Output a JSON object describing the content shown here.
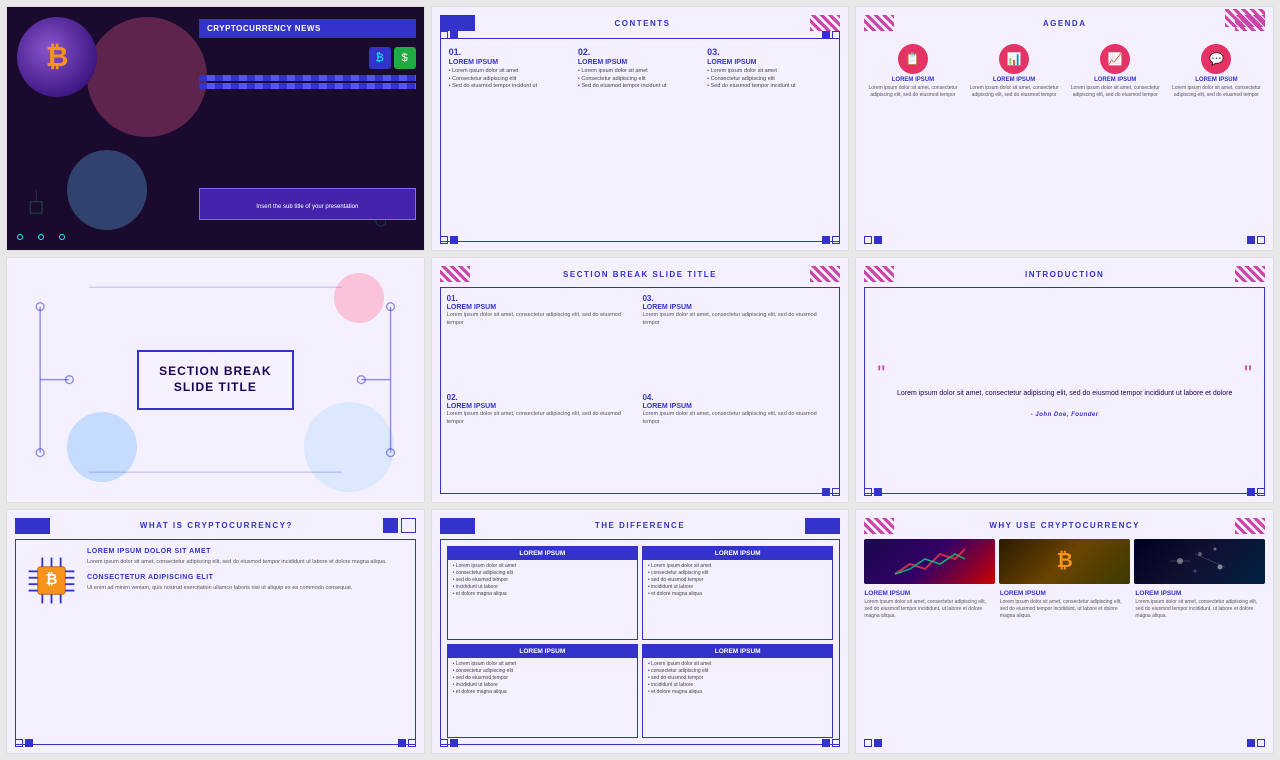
{
  "slides": [
    {
      "id": 1,
      "type": "title",
      "title": "CRYPTOCURRENCY NEWS",
      "subtitle": "Insert the sub title of your presentation"
    },
    {
      "id": 2,
      "type": "contents",
      "header": "CONTENTS",
      "items": [
        {
          "num": "01.",
          "heading": "LOREM IPSUM",
          "bullets": [
            "Lorem ipsum dolor sit amet",
            "Consectetur adipiscing elit",
            "Sed do eiusmod tempor incidunt ut"
          ]
        },
        {
          "num": "02.",
          "heading": "LOREM IPSUM",
          "bullets": [
            "Lorem ipsum dolor sit amet",
            "Consectetur adipiscing elit",
            "Sed do eiusmod tempor incidunt ut"
          ]
        },
        {
          "num": "03.",
          "heading": "LOREM IPSUM",
          "bullets": [
            "Lorem ipsum dolor sit amet",
            "Consectetur adipiscing elit",
            "Sed do eiusmod tempor incidunt ut"
          ]
        }
      ]
    },
    {
      "id": 3,
      "type": "agenda",
      "header": "AGENDA",
      "items": [
        {
          "icon": "📋",
          "label": "LOREM IPSUM",
          "desc": "Lorem ipsum dolor sit amet, consectetur adipiscing elit, sed do eiusmod tempor"
        },
        {
          "icon": "📊",
          "label": "LOREM IPSUM",
          "desc": "Lorem ipsum dolor sit amet, consectetur adipiscing elit, sed do eiusmod tempor"
        },
        {
          "icon": "📈",
          "label": "LOREM IPSUM",
          "desc": "Lorem ipsum dolor sit amet, consectetur adipiscing elit, sed do eiusmod tempor"
        },
        {
          "icon": "💬",
          "label": "LOREM IPSUM",
          "desc": "Lorem ipsum dolor sit amet, consectetur adipiscing elit, sed do eiusmod tempor"
        }
      ]
    },
    {
      "id": 4,
      "type": "section-break",
      "title": "SECTION BREAK\nSLIDE TITLE"
    },
    {
      "id": 5,
      "type": "section-break-detail",
      "header": "SECTION BREAK SLIDE TITLE",
      "items": [
        {
          "num": "01.",
          "heading": "LOREM IPSUM",
          "text": "Lorem ipsum dolor sit amet, consectetur adipiscing elit, sed do eiusmod tempor"
        },
        {
          "num": "03.",
          "heading": "LOREM IPSUM",
          "text": "Lorem ipsum dolor sit amet, consectetur adipiscing elit, sed do eiusmod tempor"
        },
        {
          "num": "02.",
          "heading": "LOREM IPSUM",
          "text": "Lorem ipsum dolor sit amet, consectetur adipiscing elit, sed do eiusmod tempor"
        },
        {
          "num": "04.",
          "heading": "LOREM IPSUM",
          "text": "Lorem ipsum dolor sit amet, consectetur adipiscing elit, sed do eiusmod tempor"
        }
      ]
    },
    {
      "id": 6,
      "type": "introduction",
      "header": "INTRODUCTION",
      "quote": "Lorem ipsum dolor sit amet, consectetur adipiscing elit, sed do eiusmod tempor incididunt ut labore et dolore",
      "author": "- John Doe, Founder"
    },
    {
      "id": 7,
      "type": "what-is",
      "header": "WHAT IS CRYPTOCURRENCY?",
      "sections": [
        {
          "heading": "LOREM IPSUM DOLOR SIT AMET",
          "text": "Lorem ipsum dolor sit amet, consectetur adipiscing elit, sed do eiusmod tempor incididunt ut labore et dolore magna aliqua."
        },
        {
          "heading": "CONSECTETUR ADIPISCING ELIT",
          "text": "Ut enim ad minim veniam, quis nostrud exercitation ullamco laboris nisi ut aliquip ex ea commodo consequat."
        }
      ]
    },
    {
      "id": 8,
      "type": "difference",
      "header": "THE DIFFERENCE",
      "cells": [
        {
          "header": "LOREM IPSUM",
          "items": [
            "Lorem ipsum dolor sit amet",
            "consectetur adipiscing elit",
            "sed do eiusmod tempor",
            "incididunt ut labore",
            "et dolore magna aliqua"
          ]
        },
        {
          "header": "LOREM IPSUM",
          "items": [
            "Lorem ipsum dolor sit amet",
            "consectetur adipiscing elit",
            "sed do eiusmod tempor",
            "incididunt ut labore",
            "et dolore magna aliqua"
          ]
        },
        {
          "header": "LOREM IPSUM",
          "items": [
            "Lorem ipsum dolor sit amet",
            "consectetur adipiscing elit",
            "sed do eiusmod tempor",
            "incididunt ut labore",
            "et dolore magna aliqua"
          ]
        },
        {
          "header": "LOREM IPSUM",
          "items": [
            "Lorem ipsum dolor sit amet",
            "consectetur adipiscing elit",
            "sed do eiusmod tempor",
            "incididunt ut labore",
            "et dolore magna aliqua"
          ]
        }
      ]
    },
    {
      "id": 9,
      "type": "why",
      "header": "WHY USE CRYPTOCURRENCY",
      "whyItems": [
        {
          "label": "LOREM IPSUM",
          "text": "Lorem ipsum dolor sit amet, consectetur adipiscing elit, sed do eiusmod tempor incididunt, ut labore et dolore magna aliqua."
        },
        {
          "label": "LOREM IPSUM",
          "text": "Lorem ipsum dolor sit amet, consectetur adipiscing elit, sed do eiusmod tempor incididunt, ut labore et dolore magna aliqua."
        },
        {
          "label": "LOREM IPSUM",
          "text": "Lorem ipsum dolor sit amet, consectetur adipiscing elit, sed do eiusmod tempor incididunt, ut labore et dolore magna aliqua."
        }
      ]
    }
  ]
}
